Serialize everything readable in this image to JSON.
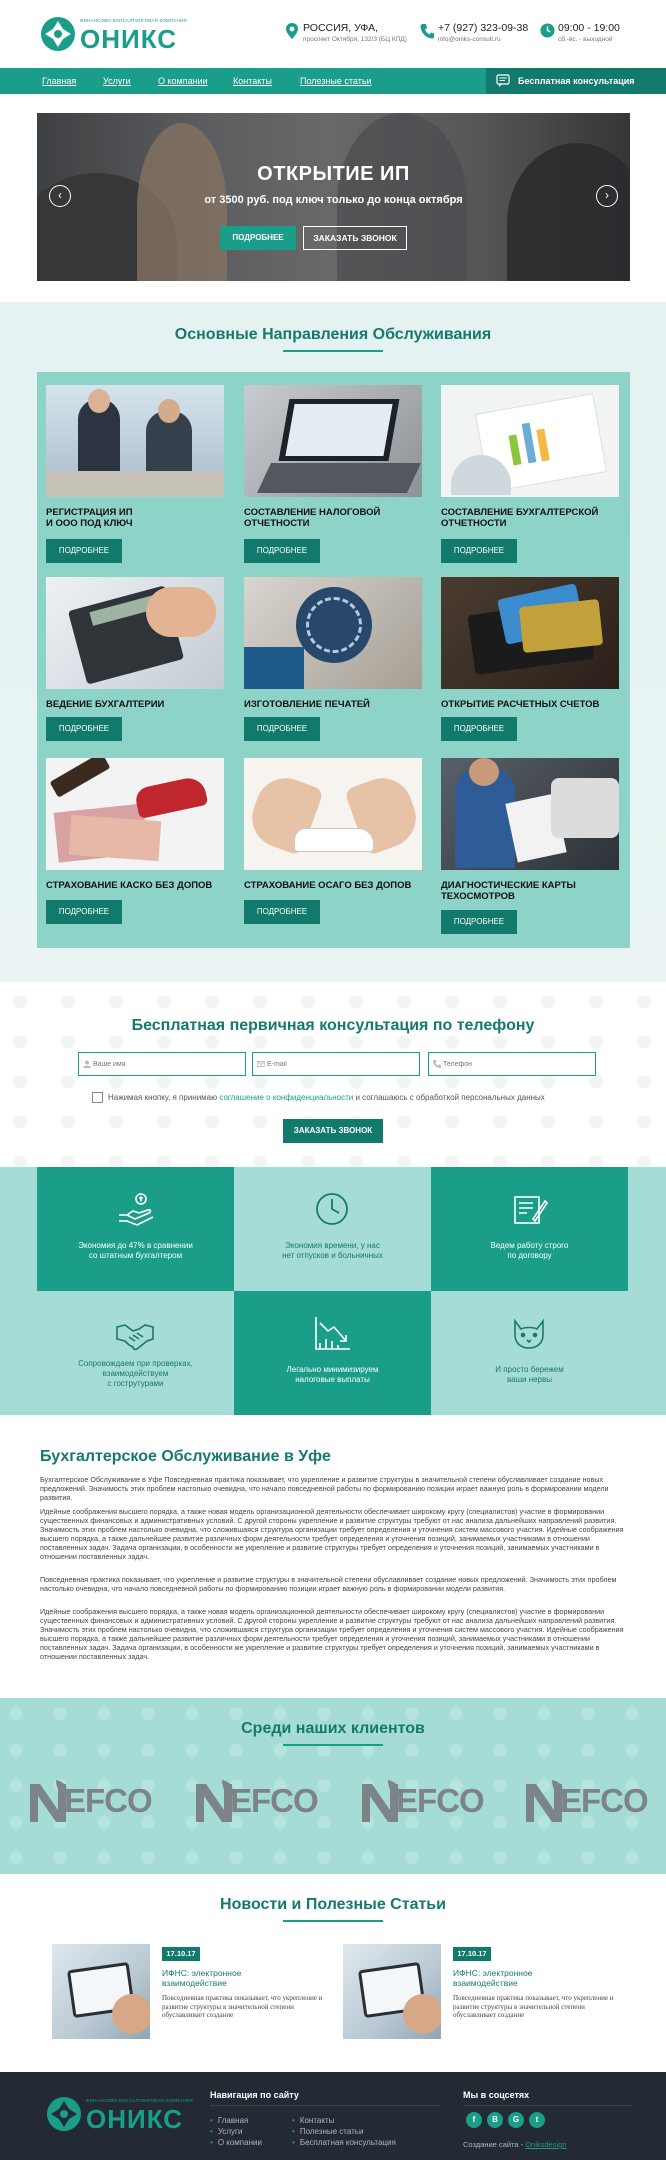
{
  "header": {
    "logo_small": "ФИНАНСОВО-КОНСАЛТИНГОВАЯ КОМПАНИЯ",
    "logo_name": "ОНИКС",
    "address_main": "РОССИЯ, УФА,",
    "address_sub": "проспект Октября, 132/3 (БЦ КПД)",
    "phone_main": "+7 (927) 323-09-38",
    "phone_sub": "info@oniks-consult.ru",
    "hours_main": "09:00 - 19:00",
    "hours_sub": "сб.-вс. - выходной"
  },
  "nav": {
    "items": [
      "Главная",
      "Услуги",
      "О компании",
      "Контакты",
      "Полезные статьи"
    ],
    "cta": "Бесплатная консультация"
  },
  "hero": {
    "title": "ОТКРЫТИЕ ИП",
    "subtitle": "от 3500 руб. под ключ только до конца октября",
    "btn_more": "ПОДРОБНЕЕ",
    "btn_call": "ЗАКАЗАТЬ ЗВОНОК",
    "prev": "‹",
    "next": "›"
  },
  "services": {
    "title": "Основные Направления Обслуживания",
    "btn_label": "ПОДРОБНЕЕ",
    "items": [
      {
        "line1": "РЕГИСТРАЦИЯ ИП",
        "line2": "И ООО ПОД КЛЮЧ"
      },
      {
        "line1": "СОСТАВЛЕНИЕ НАЛОГОВОЙ",
        "line2": "ОТЧЕТНОСТИ"
      },
      {
        "line1": "СОСТАВЛЕНИЕ БУХГАЛТЕРСКОЙ",
        "line2": "ОТЧЕТНОСТИ"
      },
      {
        "line1": "ВЕДЕНИЕ БУХГАЛТЕРИИ",
        "line2": ""
      },
      {
        "line1": "ИЗГОТОВЛЕНИЕ ПЕЧАТЕЙ",
        "line2": ""
      },
      {
        "line1": "ОТКРЫТИЕ РАСЧЕТНЫХ СЧЕТОВ",
        "line2": ""
      },
      {
        "line1": "СТРАХОВАНИЕ КАСКО БЕЗ ДОПОВ",
        "line2": ""
      },
      {
        "line1": "СТРАХОВАНИЕ ОСАГО БЕЗ ДОПОВ",
        "line2": ""
      },
      {
        "line1": "ДИАГНОСТИЧЕСКИЕ КАРТЫ",
        "line2": "ТЕХОСМОТРОВ"
      }
    ]
  },
  "consult": {
    "title": "Бесплатная первичная консультация по телефону",
    "name_placeholder": "Ваше имя",
    "email_placeholder": "E-mail",
    "phone_placeholder": "Телефон",
    "agree_before": "Нажимая кнопку, я принимаю ",
    "agree_link": "соглашение о конфиденциальности",
    "agree_after": " и соглашаюсь с обработкой персональных данных",
    "button": "ЗАКАЗАТЬ ЗВОНОК"
  },
  "advantages": [
    {
      "line1": "Экономия до 47% в сравнении",
      "line2": "со штатным бухгалтером",
      "line3": ""
    },
    {
      "line1": "Экономия времени, у нас",
      "line2": "нет отпусков и больничных",
      "line3": ""
    },
    {
      "line1": "Ведем работу строго",
      "line2": "по договору",
      "line3": ""
    },
    {
      "line1": "Сопровождаем при проверках,",
      "line2": "взаимодействуем",
      "line3": "с гострутурами"
    },
    {
      "line1": "Легально минимизируем",
      "line2": "налоговые выплаты",
      "line3": ""
    },
    {
      "line1": "И просто бережем",
      "line2": "ваши нервы",
      "line3": ""
    }
  ],
  "about": {
    "title": "Бухгалтерское Обслуживание в Уфе",
    "p1": "Бухгалтерское Обслуживание в Уфе Повседневная практика показывает, что укрепление и развитие структуры в значительной степени обуславливает создание новых предложений. Значимость этих проблем настолько очевидна, что начало повседневной работы по формированию позиции играет важную роль в формировании модели развития.",
    "p2": "Идейные соображения высшего порядка, а также новая модель организационной деятельности обеспечивает широкому кругу (специалистов) участие в формировании существенных финансовых и административных условий. С другой стороны укрепление и развитие структуры требуют от нас анализа дальнейших направлений развития. Значимость этих проблем настолько очевидна, что сложившаяся структура организации требует определения и уточнения систем массового участия. Идейные соображения высшего порядка, а также дальнейшее развитие различных форм деятельности требует определения и уточнения позиций, занимаемых участниками в отношении поставленных задач. Задача организации, в особенности же укрепление и развитие структуры требует определения и уточнения позиций, занимаемых участниками в отношении поставленных задач.",
    "p3": "Повседневная практика показывает, что укрепление и развитие структуры в значительной степени обуславливает создание новых предложений. Значимость этих проблем настолько очевидна, что начало повседневной работы по формированию позиции играет важную роль в формировании модели развития.",
    "p4": "Идейные соображения высшего порядка, а также новая модель организационной деятельности обеспечивает широкому кругу (специалистов) участие в формировании существенных финансовых и административных условий. С другой стороны укрепление и развитие структуры требуют от нас анализа дальнейших направлений развития. Значимость этих проблем настолько очевидна, что сложившаяся структура организации требует определения и уточнения систем массового участия. Идейные соображения высшего порядка, а также дальнейшее развитие различных форм деятельности требует определения и уточнения позиций, занимаемых участниками в отношении поставленных задач. Задача организации, в особенности же укрепление и развитие структуры требует определения и уточнения позиций, занимаемых участниками в отношении поставленных задач."
  },
  "clients": {
    "title": "Среди наших клиентов",
    "logo_name": "EFCO"
  },
  "news": {
    "title": "Новости и Полезные Статьи",
    "items": [
      {
        "date": "17.10.17",
        "title": "ИФНС: электронное взаимодействие",
        "text": "Повседневная практика показывает, что укрепление и развитие структуры в значительной степени обуславливает создание"
      },
      {
        "date": "17.10.17",
        "title": "ИФНС: электронное взаимодействие",
        "text": "Повседневная практика показывает, что укрепление и развитие структуры в значительной степени обуславливает создание"
      }
    ]
  },
  "footer": {
    "nav_title": "Навигация по сайту",
    "col1": [
      "Главная",
      "Услуги",
      "О компании"
    ],
    "col2": [
      "Контакты",
      "Полезные статьи",
      "Бесплатная консультация"
    ],
    "social_title": "Мы в соцсетях",
    "socials": [
      "f",
      "В",
      "G",
      "t"
    ],
    "credit_label": "Создание сайта - ",
    "credit_link": "Oniksdesign"
  },
  "colors": {
    "brand": "#1a9e8a",
    "brand_dark": "#127a6c",
    "title_green": "#157a6b",
    "panel_teal": "#8dd3c8",
    "light_teal": "#a6dcd6",
    "footer_bg": "#232a33"
  }
}
